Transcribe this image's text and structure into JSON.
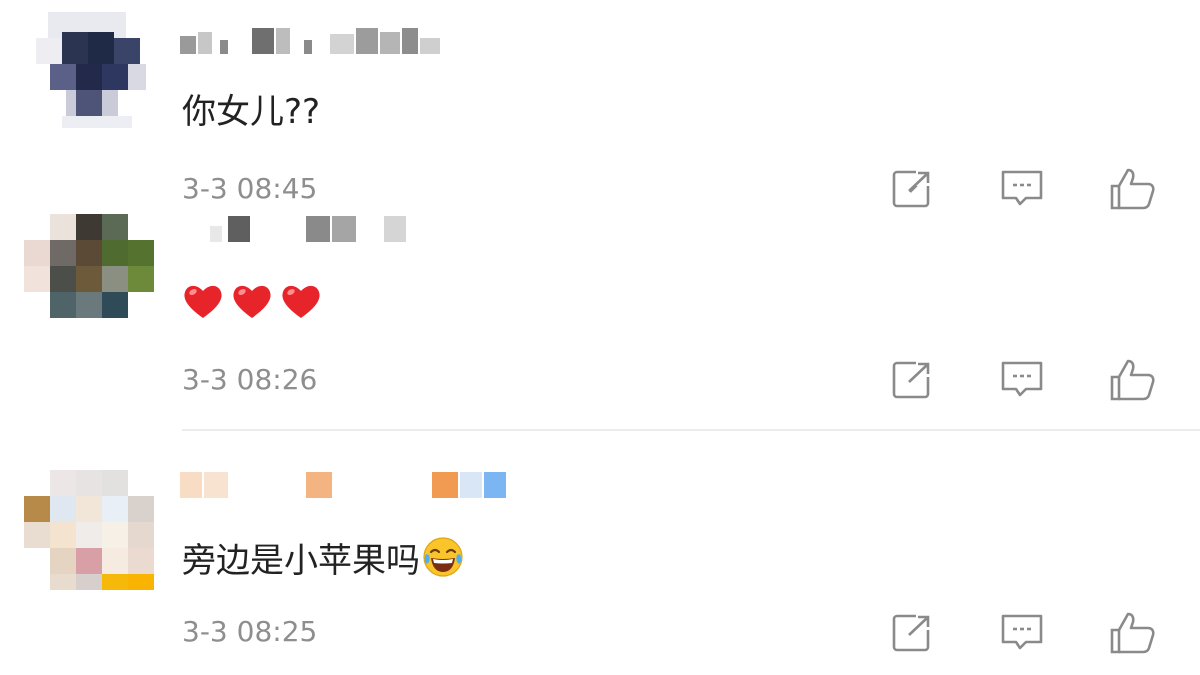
{
  "comments": [
    {
      "text": "你女儿??",
      "time": "3-3 08:45",
      "icons": {
        "repost": "share-icon",
        "reply": "comment-icon",
        "like": "thumbs-up-icon"
      }
    },
    {
      "text": "❤❤❤",
      "time": "3-3 08:26",
      "icons": {
        "repost": "share-icon",
        "reply": "comment-icon",
        "like": "thumbs-up-icon"
      }
    },
    {
      "text": "旁边是小苹果吗",
      "time": "3-3 08:25",
      "emoji": "tears-of-joy-emoji",
      "icons": {
        "repost": "share-icon",
        "reply": "comment-icon",
        "like": "thumbs-up-icon"
      }
    }
  ],
  "colors": {
    "heart": "#e8242b",
    "icon": "#8a8a8a",
    "time": "#8e8e8e",
    "text": "#222222"
  }
}
